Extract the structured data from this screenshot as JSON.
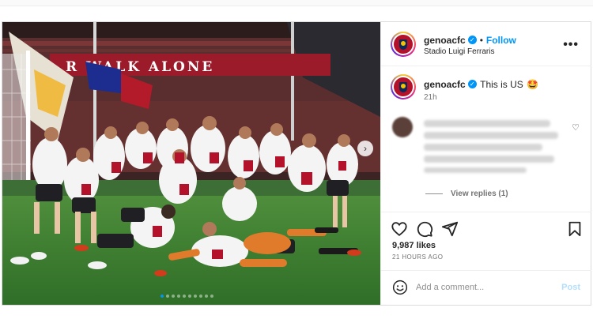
{
  "post": {
    "username": "genoacfc",
    "verified_icon": "verified-badge-icon",
    "follow_label": "Follow",
    "separator": "•",
    "location": "Stadio Luigi Ferraris",
    "more_label": "•••"
  },
  "caption": {
    "username": "genoacfc",
    "text": "This is US",
    "emoji": "🤩",
    "time": "21h"
  },
  "comment": {
    "view_replies": "View replies (1)"
  },
  "banner_text": "R WALK ALONE",
  "actions": {
    "likes": "9,987 likes",
    "time_ago": "21 HOURS AGO"
  },
  "add_comment": {
    "placeholder": "Add a comment...",
    "post_label": "Post"
  },
  "carousel": {
    "count": 10,
    "active_index": 0
  },
  "colors": {
    "accent": "#0095f6",
    "genoa_red": "#b3122a",
    "genoa_blue": "#0b2a5b"
  }
}
